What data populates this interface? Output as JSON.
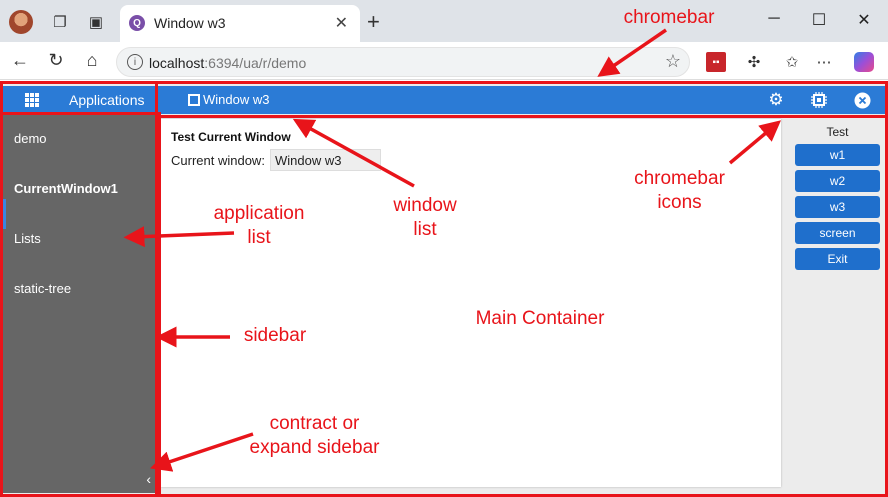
{
  "browser": {
    "tab_title": "Window w3",
    "favicon_glyph": "Q",
    "url_host": "localhost",
    "url_rest": ":6394/ua/r/demo",
    "tab_close": "✕",
    "new_tab": "+"
  },
  "app": {
    "sidebar_title": "Applications",
    "apps": [
      "demo",
      "CurrentWindow1",
      "Lists",
      "static-tree"
    ],
    "active_app": "CurrentWindow1",
    "collapse_glyph": "‹",
    "window_list": [
      "Window w3"
    ],
    "chromebar_icons": [
      "gear-icon",
      "chip-icon",
      "close-circle-icon"
    ]
  },
  "main": {
    "title": "Test Current Window",
    "current_window_label": "Current window:",
    "current_window_value": "Window w3"
  },
  "test_panel": {
    "title": "Test",
    "buttons": [
      "w1",
      "w2",
      "w3",
      "screen",
      "Exit"
    ]
  },
  "annotations": {
    "chromebar": "chromebar",
    "window_list": "window\nlist",
    "chromebar_icons": "chromebar\nicons",
    "application_list": "application\nlist",
    "main_container": "Main Container",
    "sidebar": "sidebar",
    "contract": "contract or\nexpand sidebar"
  },
  "colors": {
    "accent": "#2b7bd6",
    "sidebar_bg": "#666666",
    "annotation": "#e8141a",
    "button": "#1f6fcc"
  }
}
